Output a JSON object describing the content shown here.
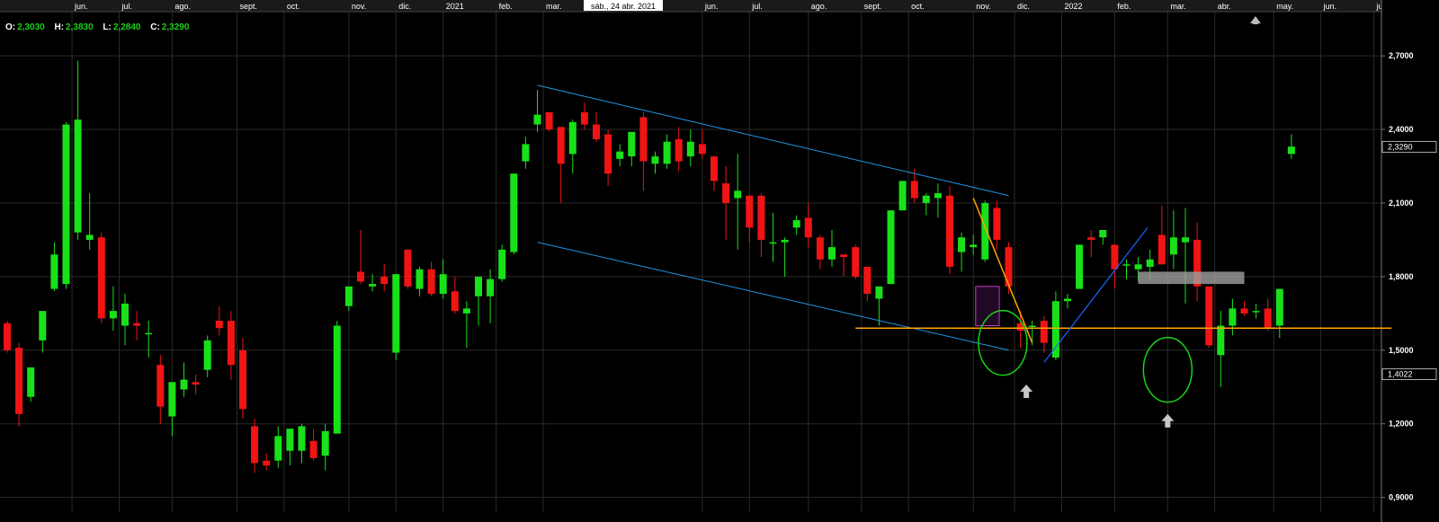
{
  "ohlc": {
    "o_label": "O:",
    "o": "2,3030",
    "h_label": "H:",
    "h": "2,3830",
    "l_label": "L:",
    "l": "2,2840",
    "c_label": "C:",
    "c": "2,3290"
  },
  "hover_date": "sáb., 24 abr. 2021",
  "price_tags": {
    "last": "2,3290",
    "cursor": "1,4022"
  },
  "colors": {
    "up": "#19e119",
    "down": "#f01414",
    "grid": "#2a2a2a",
    "text": "#ffffff",
    "channel": "#1e96e6",
    "orange": "#ffa500",
    "blue_trend": "#1e64ff",
    "circle": "#19d219",
    "purple": "#c43cc4",
    "resistance": "#a0a0a0"
  },
  "chart_data": {
    "type": "candlestick",
    "title": "",
    "ylim": [
      0.84,
      2.88
    ],
    "y_ticks": [
      {
        "value": 0.9,
        "label": "0,9000"
      },
      {
        "value": 1.2,
        "label": "1,2000"
      },
      {
        "value": 1.5,
        "label": "1,5000"
      },
      {
        "value": 1.8,
        "label": "1,8000"
      },
      {
        "value": 2.1,
        "label": "2,1000"
      },
      {
        "value": 2.4,
        "label": "2,4000"
      },
      {
        "value": 2.7,
        "label": "2,7000"
      }
    ],
    "x_labels": [
      {
        "i": 5.5,
        "label": "jun."
      },
      {
        "i": 9.5,
        "label": "jul."
      },
      {
        "i": 14,
        "label": "ago."
      },
      {
        "i": 19.5,
        "label": "sept."
      },
      {
        "i": 23.5,
        "label": "oct."
      },
      {
        "i": 29,
        "label": "nov."
      },
      {
        "i": 33,
        "label": "dic."
      },
      {
        "i": 37,
        "label": "2021"
      },
      {
        "i": 41.5,
        "label": "feb."
      },
      {
        "i": 45.5,
        "label": "mar."
      },
      {
        "i": 59,
        "label": "jun."
      },
      {
        "i": 63,
        "label": "jul."
      },
      {
        "i": 68,
        "label": "ago."
      },
      {
        "i": 72.5,
        "label": "sept."
      },
      {
        "i": 76.5,
        "label": "oct."
      },
      {
        "i": 82,
        "label": "nov."
      },
      {
        "i": 85.5,
        "label": "dic."
      },
      {
        "i": 89.5,
        "label": "2022"
      },
      {
        "i": 94,
        "label": "feb."
      },
      {
        "i": 98.5,
        "label": "mar."
      },
      {
        "i": 102.5,
        "label": "abr."
      },
      {
        "i": 107.5,
        "label": "may."
      },
      {
        "i": 111.5,
        "label": "jun."
      },
      {
        "i": 116,
        "label": "jul."
      }
    ],
    "candles": [
      [
        1.61,
        1.62,
        1.49,
        1.5
      ],
      [
        1.51,
        1.53,
        1.19,
        1.24
      ],
      [
        1.31,
        1.41,
        1.29,
        1.43
      ],
      [
        1.54,
        1.64,
        1.49,
        1.66
      ],
      [
        1.75,
        1.94,
        1.74,
        1.89
      ],
      [
        1.77,
        2.43,
        1.75,
        2.42
      ],
      [
        1.98,
        2.68,
        1.95,
        2.44
      ],
      [
        1.95,
        2.14,
        1.91,
        1.97
      ],
      [
        1.96,
        1.98,
        1.61,
        1.63
      ],
      [
        1.63,
        1.76,
        1.58,
        1.66
      ],
      [
        1.6,
        1.73,
        1.52,
        1.69
      ],
      [
        1.61,
        1.66,
        1.54,
        1.6
      ],
      [
        1.57,
        1.62,
        1.47,
        1.57
      ],
      [
        1.44,
        1.48,
        1.2,
        1.27
      ],
      [
        1.23,
        1.37,
        1.15,
        1.37
      ],
      [
        1.34,
        1.45,
        1.31,
        1.38
      ],
      [
        1.37,
        1.4,
        1.32,
        1.36
      ],
      [
        1.42,
        1.56,
        1.39,
        1.54
      ],
      [
        1.62,
        1.68,
        1.56,
        1.59
      ],
      [
        1.62,
        1.66,
        1.38,
        1.44
      ],
      [
        1.5,
        1.55,
        1.22,
        1.26
      ],
      [
        1.19,
        1.22,
        1.0,
        1.04
      ],
      [
        1.05,
        1.08,
        1.01,
        1.03
      ],
      [
        1.05,
        1.19,
        1.02,
        1.15
      ],
      [
        1.09,
        1.17,
        1.03,
        1.18
      ],
      [
        1.09,
        1.2,
        1.04,
        1.19
      ],
      [
        1.13,
        1.18,
        1.05,
        1.06
      ],
      [
        1.07,
        1.2,
        1.01,
        1.17
      ],
      [
        1.16,
        1.62,
        1.16,
        1.6
      ],
      [
        1.68,
        1.76,
        1.66,
        1.76
      ],
      [
        1.82,
        1.99,
        1.77,
        1.78
      ],
      [
        1.76,
        1.81,
        1.74,
        1.77
      ],
      [
        1.8,
        1.85,
        1.74,
        1.77
      ],
      [
        1.49,
        1.81,
        1.46,
        1.81
      ],
      [
        1.91,
        1.91,
        1.75,
        1.76
      ],
      [
        1.75,
        1.84,
        1.72,
        1.83
      ],
      [
        1.83,
        1.86,
        1.72,
        1.73
      ],
      [
        1.73,
        1.87,
        1.71,
        1.81
      ],
      [
        1.74,
        1.8,
        1.65,
        1.66
      ],
      [
        1.65,
        1.7,
        1.51,
        1.67
      ],
      [
        1.72,
        1.79,
        1.6,
        1.8
      ],
      [
        1.72,
        1.83,
        1.61,
        1.79
      ],
      [
        1.79,
        1.93,
        1.78,
        1.91
      ],
      [
        1.9,
        2.22,
        1.89,
        2.22
      ],
      [
        2.27,
        2.37,
        2.24,
        2.34
      ],
      [
        2.42,
        2.56,
        2.39,
        2.46
      ],
      [
        2.47,
        2.47,
        2.39,
        2.4
      ],
      [
        2.41,
        2.29,
        2.1,
        2.26
      ],
      [
        2.3,
        2.44,
        2.22,
        2.43
      ],
      [
        2.47,
        2.51,
        2.4,
        2.42
      ],
      [
        2.42,
        2.47,
        2.35,
        2.36
      ],
      [
        2.38,
        2.4,
        2.17,
        2.22
      ],
      [
        2.28,
        2.34,
        2.25,
        2.31
      ],
      [
        2.29,
        2.36,
        2.25,
        2.39
      ],
      [
        2.45,
        2.47,
        2.15,
        2.27
      ],
      [
        2.26,
        2.31,
        2.22,
        2.29
      ],
      [
        2.26,
        2.38,
        2.24,
        2.35
      ],
      [
        2.36,
        2.41,
        2.23,
        2.27
      ],
      [
        2.29,
        2.4,
        2.25,
        2.35
      ],
      [
        2.34,
        2.4,
        2.28,
        2.3
      ],
      [
        2.29,
        2.29,
        2.15,
        2.19
      ],
      [
        2.18,
        2.25,
        1.95,
        2.1
      ],
      [
        2.12,
        2.3,
        1.91,
        2.15
      ],
      [
        2.13,
        2.13,
        1.94,
        2.0
      ],
      [
        2.13,
        2.14,
        1.88,
        1.95
      ],
      [
        1.94,
        2.06,
        1.86,
        1.94
      ],
      [
        1.94,
        1.96,
        1.8,
        1.95
      ],
      [
        2.0,
        2.05,
        1.97,
        2.03
      ],
      [
        2.04,
        2.1,
        1.92,
        1.96
      ],
      [
        1.96,
        1.97,
        1.83,
        1.87
      ],
      [
        1.87,
        1.99,
        1.84,
        1.92
      ],
      [
        1.89,
        1.89,
        1.8,
        1.88
      ],
      [
        1.92,
        1.93,
        1.79,
        1.8
      ],
      [
        1.84,
        1.84,
        1.7,
        1.73
      ],
      [
        1.71,
        1.74,
        1.6,
        1.76
      ],
      [
        1.77,
        2.04,
        1.77,
        2.07
      ],
      [
        2.07,
        2.19,
        2.07,
        2.19
      ],
      [
        2.19,
        2.24,
        2.1,
        2.12
      ],
      [
        2.1,
        2.14,
        2.05,
        2.13
      ],
      [
        2.12,
        2.18,
        2.04,
        2.14
      ],
      [
        2.13,
        2.17,
        1.81,
        1.84
      ],
      [
        1.9,
        1.98,
        1.82,
        1.96
      ],
      [
        1.92,
        1.97,
        1.89,
        1.93
      ],
      [
        1.87,
        2.11,
        1.86,
        2.1
      ],
      [
        2.08,
        2.11,
        1.91,
        1.95
      ],
      [
        1.92,
        1.94,
        1.73,
        1.76
      ],
      [
        1.61,
        1.66,
        1.51,
        1.58
      ],
      [
        1.6,
        1.62,
        1.52,
        1.6
      ],
      [
        1.62,
        1.64,
        1.49,
        1.53
      ],
      [
        1.47,
        1.74,
        1.46,
        1.7
      ],
      [
        1.7,
        1.73,
        1.67,
        1.71
      ],
      [
        1.75,
        1.93,
        1.75,
        1.93
      ],
      [
        1.96,
        1.99,
        1.88,
        1.95
      ],
      [
        1.96,
        1.98,
        1.93,
        1.99
      ],
      [
        1.93,
        1.93,
        1.75,
        1.83
      ],
      [
        1.85,
        1.87,
        1.79,
        1.85
      ],
      [
        1.83,
        1.88,
        1.78,
        1.85
      ],
      [
        1.84,
        1.91,
        1.79,
        1.87
      ],
      [
        1.97,
        2.09,
        1.85,
        1.85
      ],
      [
        1.89,
        2.07,
        1.83,
        1.96
      ],
      [
        1.94,
        2.08,
        1.69,
        1.96
      ],
      [
        1.95,
        2.02,
        1.7,
        1.76
      ],
      [
        1.76,
        1.76,
        1.51,
        1.52
      ],
      [
        1.48,
        1.66,
        1.35,
        1.6
      ],
      [
        1.6,
        1.71,
        1.56,
        1.67
      ],
      [
        1.67,
        1.7,
        1.64,
        1.65
      ],
      [
        1.66,
        1.69,
        1.63,
        1.66
      ],
      [
        1.67,
        1.71,
        1.58,
        1.59
      ],
      [
        1.6,
        1.75,
        1.55,
        1.75
      ],
      [
        2.3,
        2.38,
        2.28,
        2.33
      ]
    ],
    "candle_fields": [
      "open",
      "high",
      "low",
      "close"
    ],
    "annotations": {
      "channel_upper": [
        [
          45,
          2.58
        ],
        [
          85,
          2.13
        ]
      ],
      "channel_lower": [
        [
          45,
          1.94
        ],
        [
          85,
          1.5
        ]
      ],
      "support_line": [
        [
          72,
          1.59
        ],
        [
          117.5,
          1.59
        ]
      ],
      "orange_downtrend": [
        [
          82,
          2.12
        ],
        [
          87,
          1.53
        ]
      ],
      "blue_uptrend": [
        [
          88,
          1.45
        ],
        [
          96.8,
          2.0
        ]
      ],
      "ellipse_1": {
        "i": 84.5,
        "price": 1.53
      },
      "ellipse_2": {
        "i": 98.5,
        "price": 1.42
      },
      "arrow_1": {
        "i": 86.5,
        "price": 1.36
      },
      "arrow_2": {
        "i": 98.5,
        "price": 1.24
      },
      "purple_box": {
        "i0": 82.2,
        "i1": 84.2,
        "p0": 1.6,
        "p1": 1.76
      },
      "resistance_box": {
        "i0": 96,
        "i1": 105,
        "p0": 1.77,
        "p1": 1.82
      }
    }
  }
}
